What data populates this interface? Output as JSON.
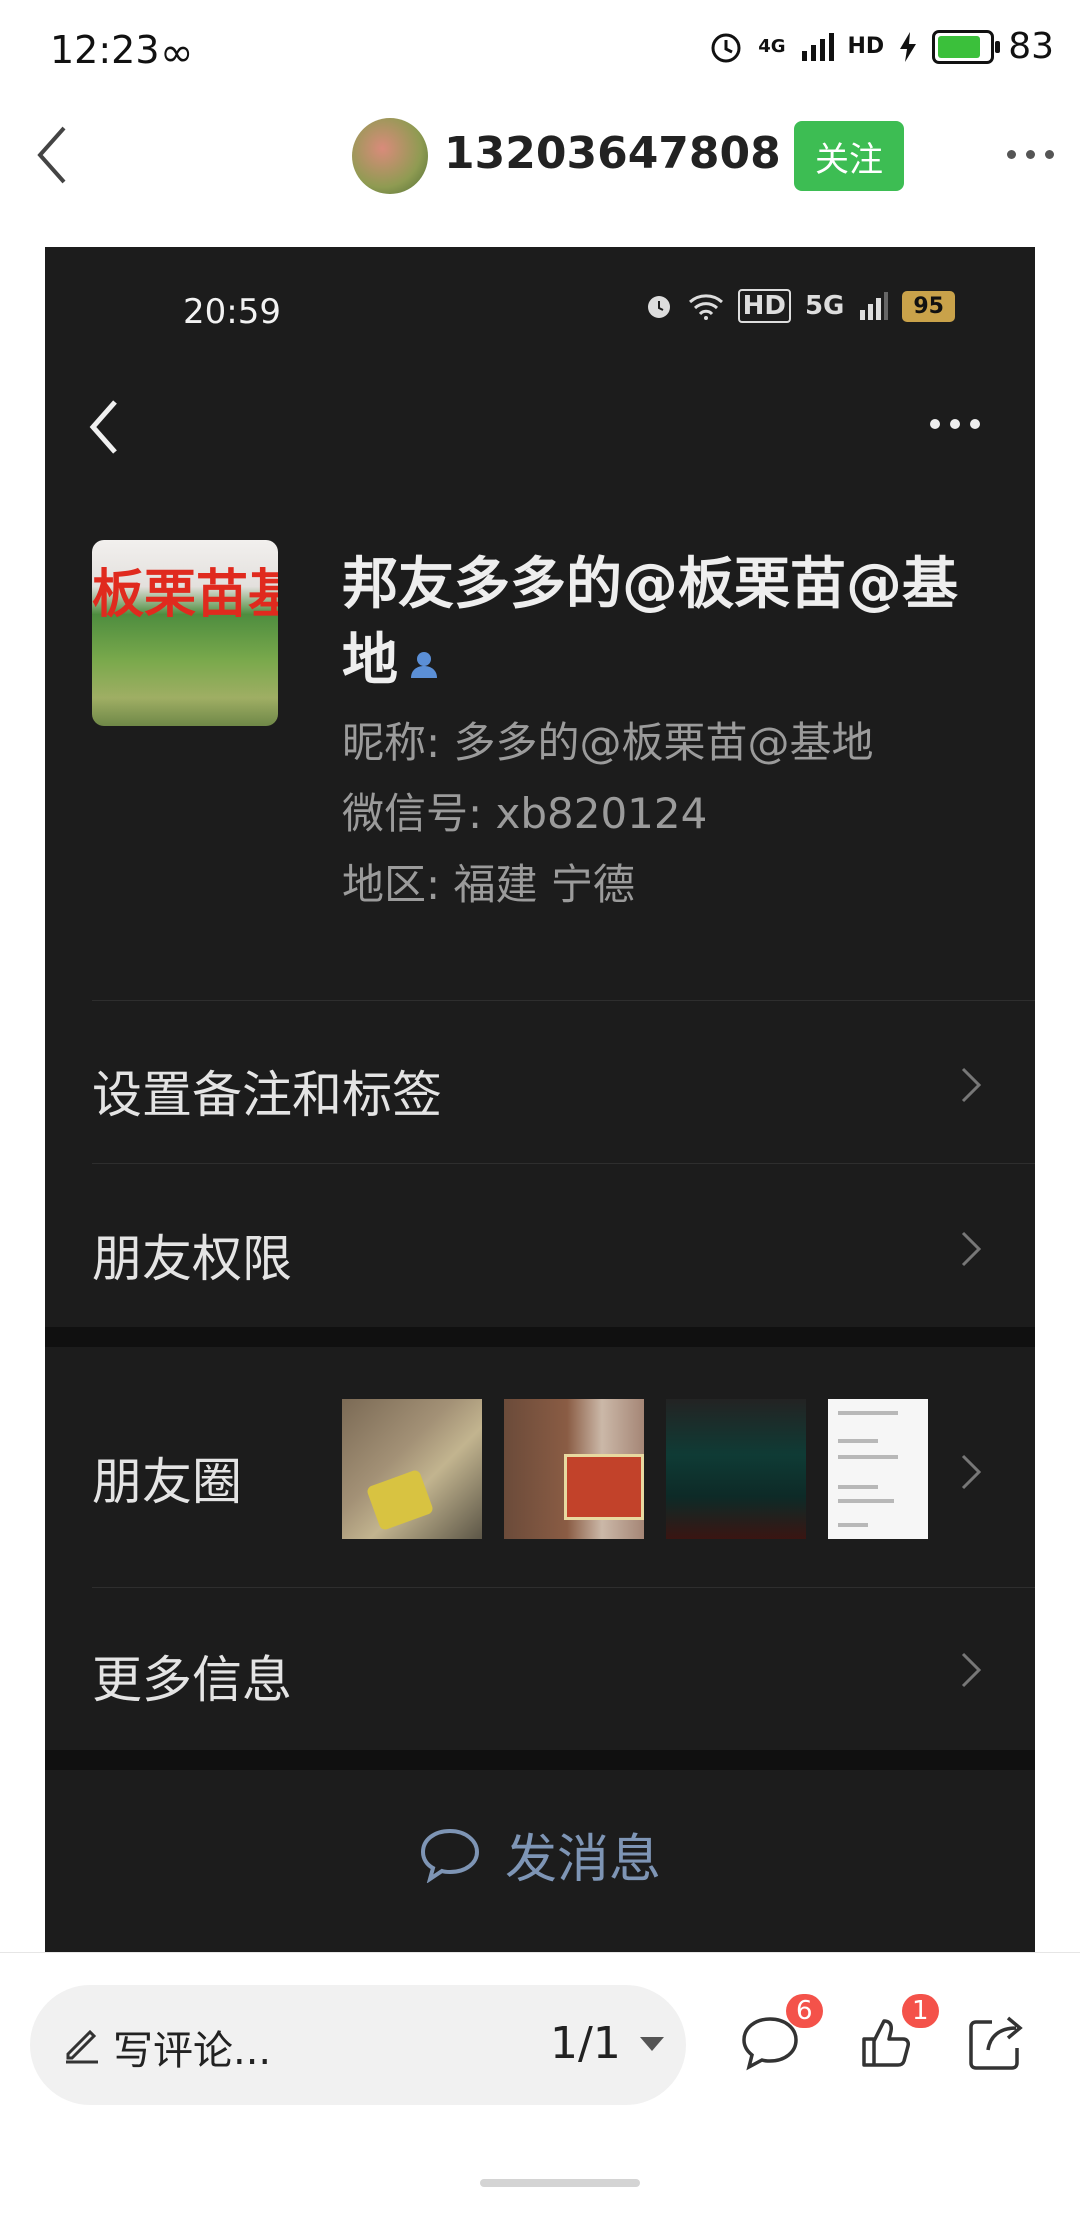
{
  "status_bar": {
    "time": "12:23",
    "loop_icon": "∞",
    "network": "4G",
    "hd": "HD",
    "battery": "83",
    "battery_level": 0.83
  },
  "header": {
    "username": "13203647808",
    "follow_label": "关注"
  },
  "screenshot": {
    "status_time": "20:59",
    "status_battery": "95",
    "status_5g": "5G",
    "status_hd": "HD",
    "avatar_text": "板栗苗基",
    "profile_name": "邦友多多的@板栗苗@基地",
    "nickname": "昵称: 多多的@板栗苗@基地",
    "wechat_id": "微信号: xb820124",
    "region": "地区: 福建 宁德",
    "rows": {
      "remark": "设置备注和标签",
      "permission": "朋友权限",
      "moments": "朋友圈",
      "more_info": "更多信息"
    },
    "message_button": "发消息"
  },
  "bottom_bar": {
    "comment_placeholder": "写评论...",
    "pager": "1/1",
    "comment_count": "6",
    "like_count": "1"
  },
  "colors": {
    "follow_green": "#3dbd53",
    "badge_red": "#f4524a",
    "dark_bg": "#1c1c1c"
  }
}
